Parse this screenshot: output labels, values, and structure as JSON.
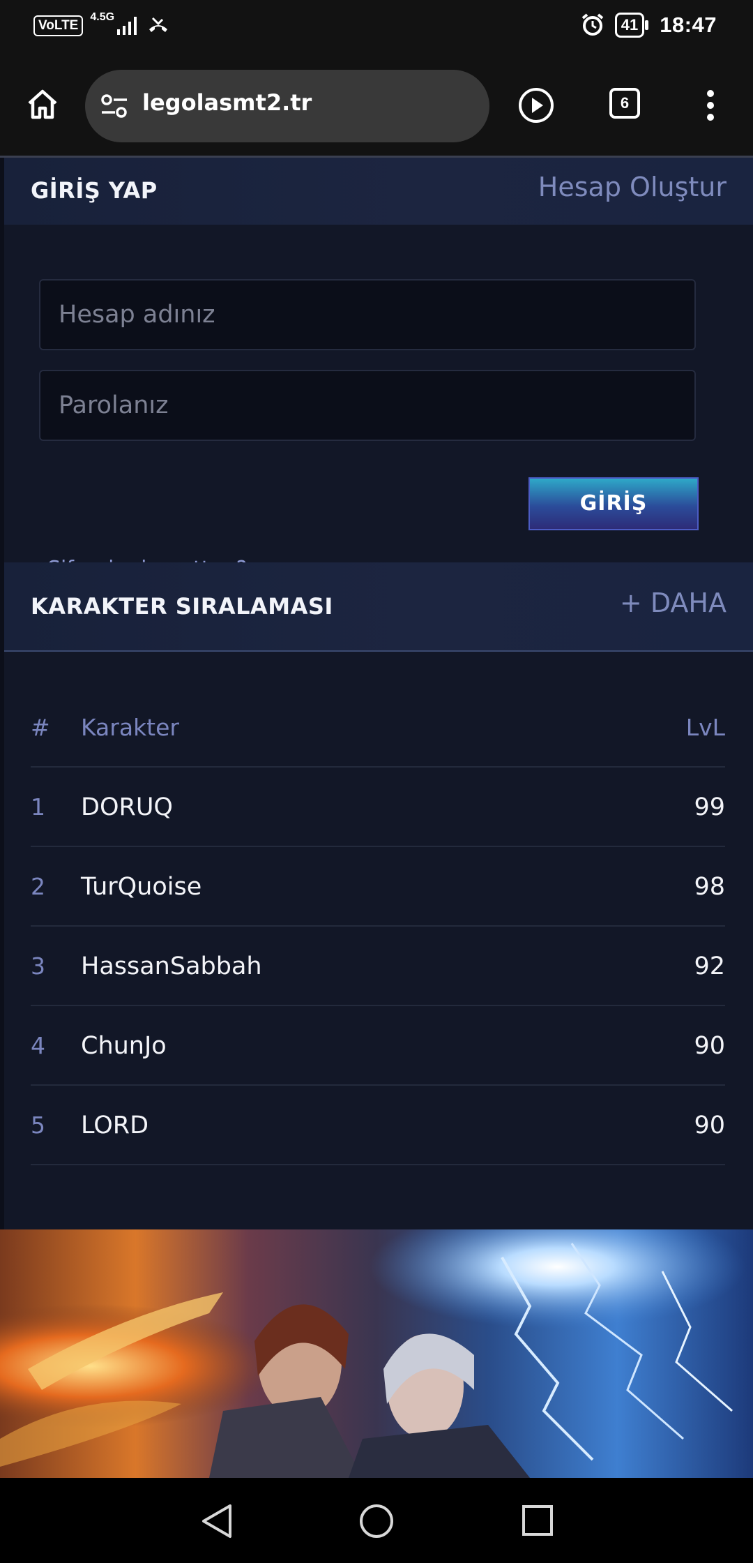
{
  "status_bar": {
    "volte": "VoLTE",
    "network": "4.5G",
    "battery": "41",
    "time": "18:47"
  },
  "browser": {
    "url": "legolasmt2.tr",
    "tab_count": "6"
  },
  "login": {
    "title": "GİRİŞ YAP",
    "create_account": "Hesap Oluştur",
    "username_placeholder": "Hesap adınız",
    "password_placeholder": "Parolanız",
    "forgot": "Şifreni mi unuttun?",
    "submit": "GİRİŞ"
  },
  "ranking": {
    "title": "KARAKTER SIRALAMASI",
    "more": "+ DAHA",
    "columns": [
      "#",
      "Karakter",
      "LvL"
    ],
    "rows": [
      {
        "rank": "1",
        "name": "DORUQ",
        "level": "99"
      },
      {
        "rank": "2",
        "name": "TurQuoise",
        "level": "98"
      },
      {
        "rank": "3",
        "name": "HassanSabbah",
        "level": "92"
      },
      {
        "rank": "4",
        "name": "ChunJo",
        "level": "90"
      },
      {
        "rank": "5",
        "name": "LORD",
        "level": "90"
      }
    ]
  },
  "colors": {
    "page_bg": "#131829",
    "accent_link": "#7f8bbd",
    "button_top": "#2ea8c8",
    "button_bottom": "#2d2c78"
  }
}
